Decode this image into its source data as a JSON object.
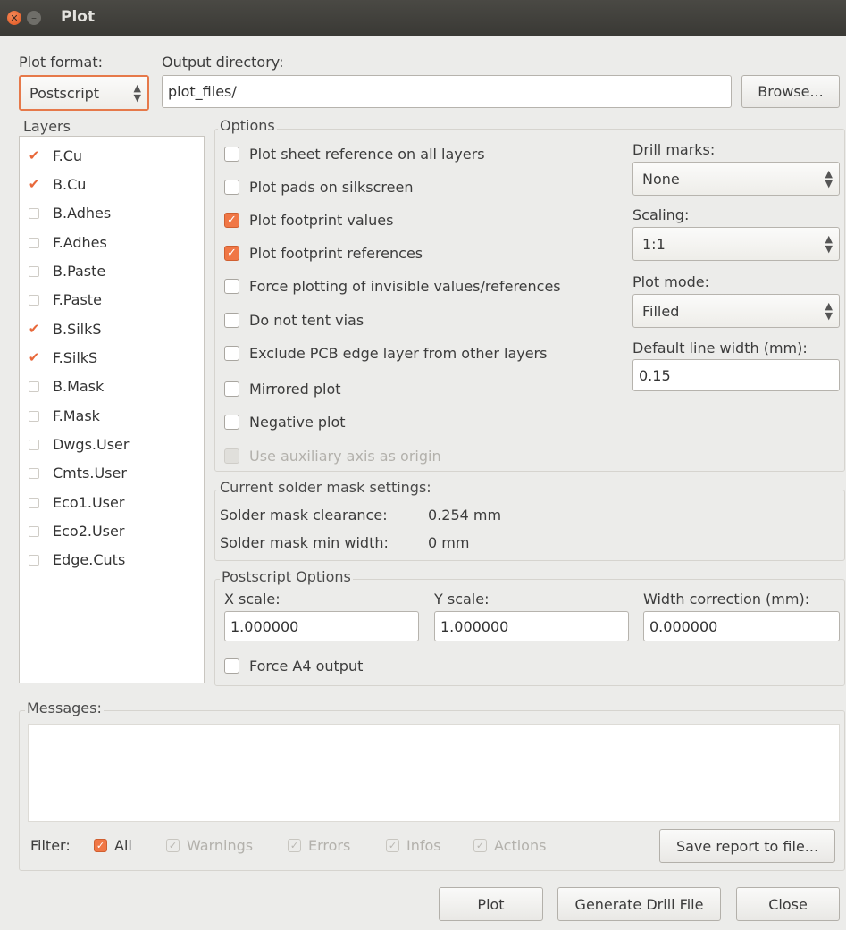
{
  "window": {
    "title": "Plot"
  },
  "plot_format": {
    "label": "Plot format:",
    "value": "Postscript"
  },
  "output_directory": {
    "label": "Output directory:",
    "value": "plot_files/",
    "browse_label": "Browse..."
  },
  "layers": {
    "title": "Layers",
    "items": [
      {
        "label": "F.Cu",
        "checked": true
      },
      {
        "label": "B.Cu",
        "checked": true
      },
      {
        "label": "B.Adhes",
        "checked": false
      },
      {
        "label": "F.Adhes",
        "checked": false
      },
      {
        "label": "B.Paste",
        "checked": false
      },
      {
        "label": "F.Paste",
        "checked": false
      },
      {
        "label": "B.SilkS",
        "checked": true
      },
      {
        "label": "F.SilkS",
        "checked": true
      },
      {
        "label": "B.Mask",
        "checked": false
      },
      {
        "label": "F.Mask",
        "checked": false
      },
      {
        "label": "Dwgs.User",
        "checked": false
      },
      {
        "label": "Cmts.User",
        "checked": false
      },
      {
        "label": "Eco1.User",
        "checked": false
      },
      {
        "label": "Eco2.User",
        "checked": false
      },
      {
        "label": "Edge.Cuts",
        "checked": false
      }
    ]
  },
  "options": {
    "title": "Options",
    "checkboxes": [
      {
        "label": "Plot sheet reference on all layers",
        "checked": false
      },
      {
        "label": "Plot pads on silkscreen",
        "checked": false
      },
      {
        "label": "Plot footprint values",
        "checked": true
      },
      {
        "label": "Plot footprint references",
        "checked": true
      },
      {
        "label": "Force plotting of invisible values/references",
        "checked": false
      },
      {
        "label": "Do not tent vias",
        "checked": false
      },
      {
        "label": "Exclude PCB edge layer from other layers",
        "checked": false
      },
      {
        "label": "Mirrored plot",
        "checked": false
      },
      {
        "label": "Negative plot",
        "checked": false
      },
      {
        "label": "Use auxiliary axis as origin",
        "checked": false,
        "disabled": true
      }
    ],
    "drill_marks": {
      "label": "Drill marks:",
      "value": "None"
    },
    "scaling": {
      "label": "Scaling:",
      "value": "1:1"
    },
    "plot_mode": {
      "label": "Plot mode:",
      "value": "Filled"
    },
    "line_width": {
      "label": "Default line width (mm):",
      "value": "0.15"
    }
  },
  "solder_mask": {
    "title": "Current solder mask settings:",
    "clearance_label": "Solder mask clearance:",
    "clearance_value": "0.254 mm",
    "min_width_label": "Solder mask min width:",
    "min_width_value": "0 mm"
  },
  "postscript": {
    "title": "Postscript Options",
    "x_scale": {
      "label": "X scale:",
      "value": "1.000000"
    },
    "y_scale": {
      "label": "Y scale:",
      "value": "1.000000"
    },
    "width_correction": {
      "label": "Width correction (mm):",
      "value": "0.000000"
    },
    "force_a4": {
      "label": "Force A4 output",
      "checked": false
    }
  },
  "messages": {
    "title": "Messages:",
    "filter_label": "Filter:",
    "filters": [
      {
        "label": "All",
        "checked": true
      },
      {
        "label": "Warnings",
        "checked": true,
        "disabled": true
      },
      {
        "label": "Errors",
        "checked": true,
        "disabled": true
      },
      {
        "label": "Infos",
        "checked": true,
        "disabled": true
      },
      {
        "label": "Actions",
        "checked": true,
        "disabled": true
      }
    ],
    "save_report_label": "Save report to file..."
  },
  "buttons": {
    "plot": "Plot",
    "generate_drill": "Generate Drill File",
    "close": "Close"
  },
  "colors": {
    "accent": "#f07746",
    "titlebar": "#3f3e3a",
    "background": "#ececea"
  }
}
